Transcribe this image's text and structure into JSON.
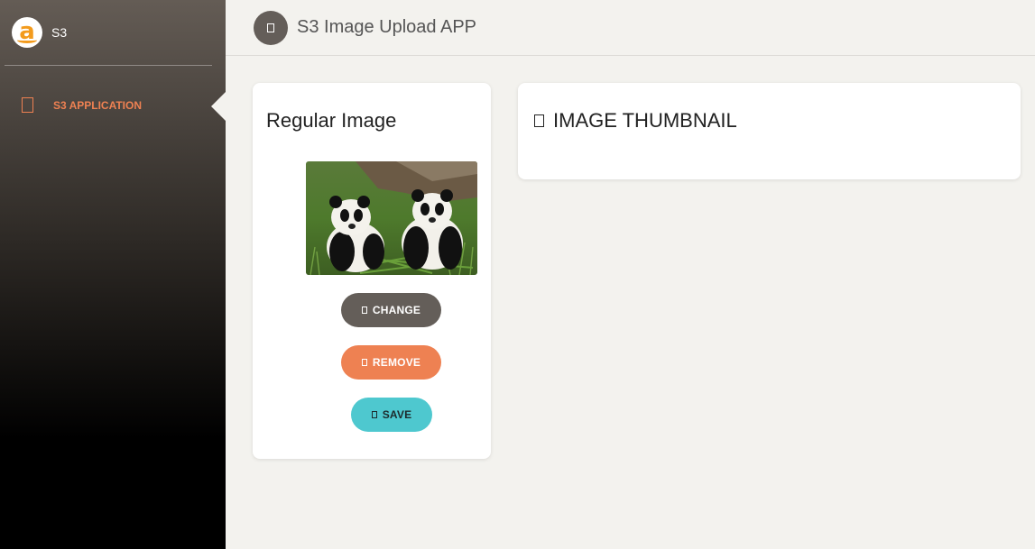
{
  "sidebar": {
    "brand_name": "S3",
    "logo_icon": "amazon-logo-icon",
    "items": [
      {
        "label": "S3 APPLICATION",
        "icon": "app-icon",
        "active": true
      }
    ]
  },
  "header": {
    "title": "S3 Image Upload APP",
    "menu_icon": "menu-icon"
  },
  "regular_card": {
    "title": "Regular Image",
    "image_icon": "panda-photo",
    "buttons": {
      "change": "CHANGE",
      "remove": "REMOVE",
      "save": "SAVE"
    }
  },
  "thumbnail_card": {
    "title": "IMAGE THUMBNAIL",
    "icon": "image-icon"
  },
  "colors": {
    "accent_orange": "#ee8152",
    "button_dark": "#645e59",
    "button_teal": "#4ec8cf",
    "logo_orange": "#f39b1d",
    "page_background": "#f3f2ee"
  }
}
